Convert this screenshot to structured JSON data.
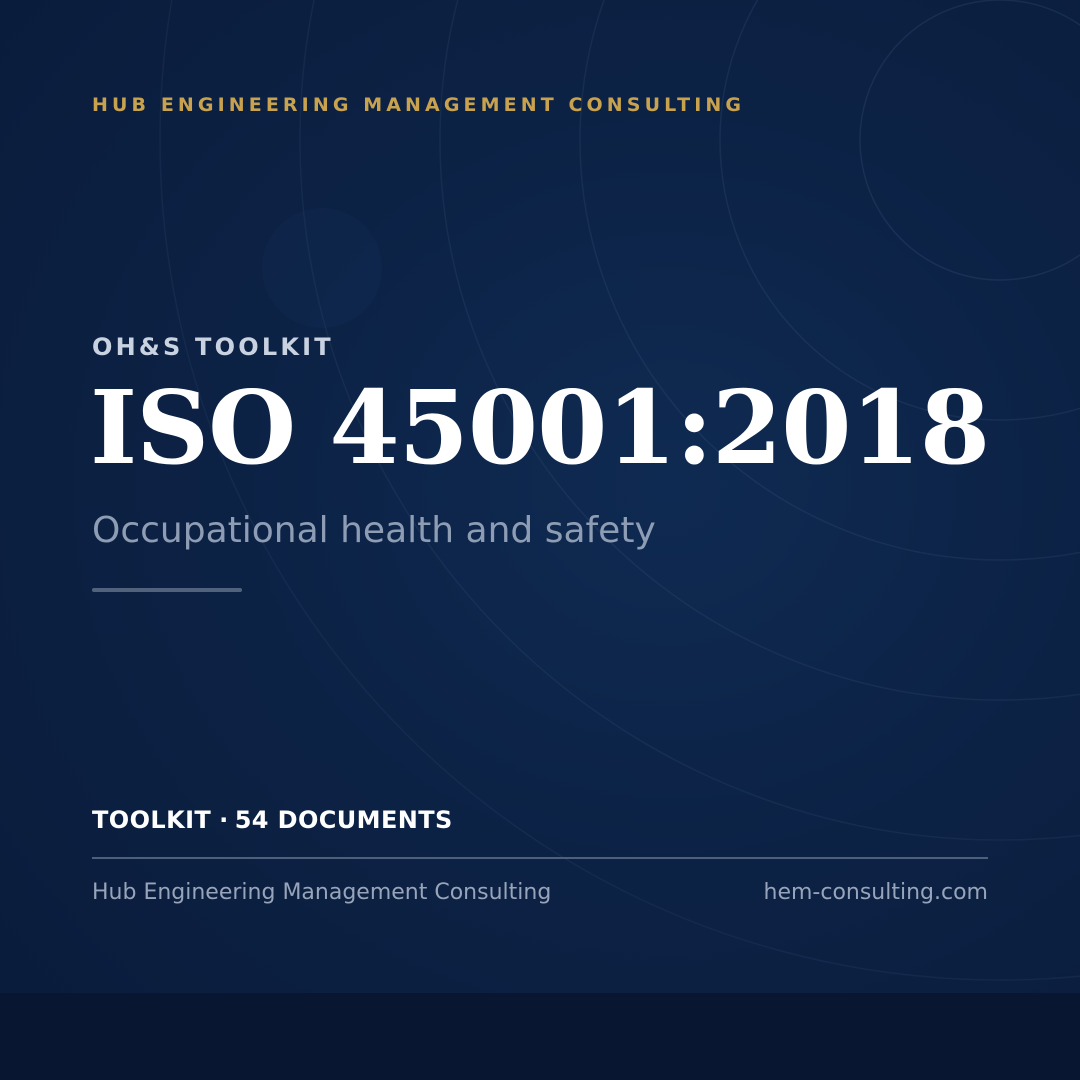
{
  "brand": {
    "name": "HUB ENGINEERING MANAGEMENT CONSULTING",
    "accent_color": "#c8a24e"
  },
  "hero": {
    "eyebrow": "OH&S TOOLKIT",
    "title": "ISO 45001:2018",
    "subtitle": "Occupational health and safety"
  },
  "meta": {
    "type": "TOOLKIT",
    "separator": "·",
    "count": "54 DOCUMENTS"
  },
  "footer": {
    "company": "Hub Engineering Management Consulting",
    "website": "hem-consulting.com"
  },
  "colors": {
    "background": "#0c2245",
    "title": "#ffffff",
    "subtitle": "#8e9db4"
  }
}
